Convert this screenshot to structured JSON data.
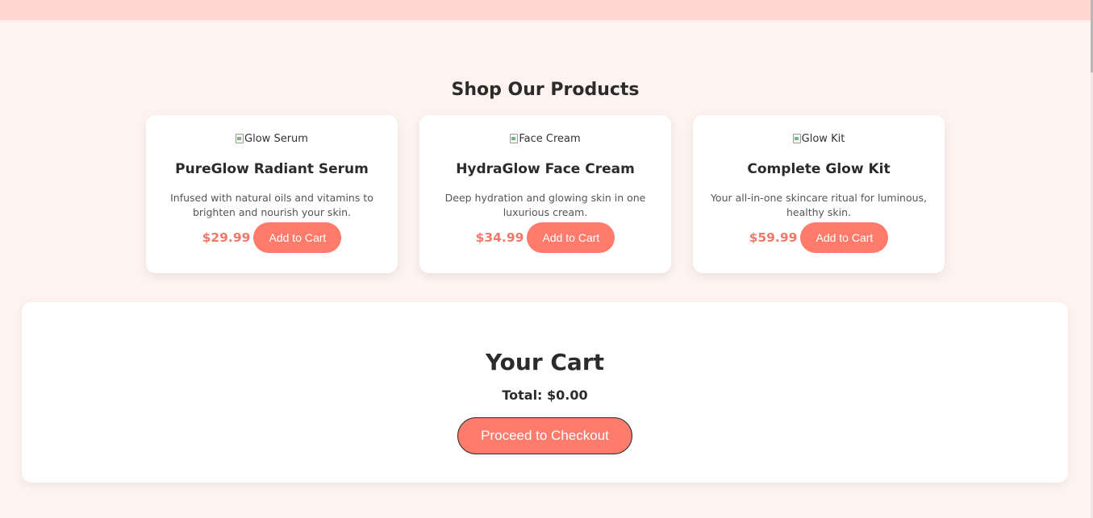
{
  "products_section": {
    "title": "Shop Our Products",
    "products": [
      {
        "image_alt": "Glow Serum",
        "name": "PureGlow Radiant Serum",
        "description": "Infused with natural oils and vitamins to brighten and nourish your skin.",
        "price": "$29.99",
        "button_label": "Add to Cart"
      },
      {
        "image_alt": "Face Cream",
        "name": "HydraGlow Face Cream",
        "description": "Deep hydration and glowing skin in one luxurious cream.",
        "price": "$34.99",
        "button_label": "Add to Cart"
      },
      {
        "image_alt": "Glow Kit",
        "name": "Complete Glow Kit",
        "description": "Your all-in-one skincare ritual for luminous, healthy skin.",
        "price": "$59.99",
        "button_label": "Add to Cart"
      }
    ]
  },
  "cart": {
    "title": "Your Cart",
    "total_label": "Total:",
    "total_value": "$0.00",
    "checkout_label": "Proceed to Checkout"
  },
  "colors": {
    "page_background": "#fff3f0",
    "banner": "#ffd5cf",
    "accent": "#ff7b6b",
    "price": "#f0786a",
    "text": "#2b2b2b"
  },
  "icons": {
    "broken_image": "broken-image-icon"
  }
}
